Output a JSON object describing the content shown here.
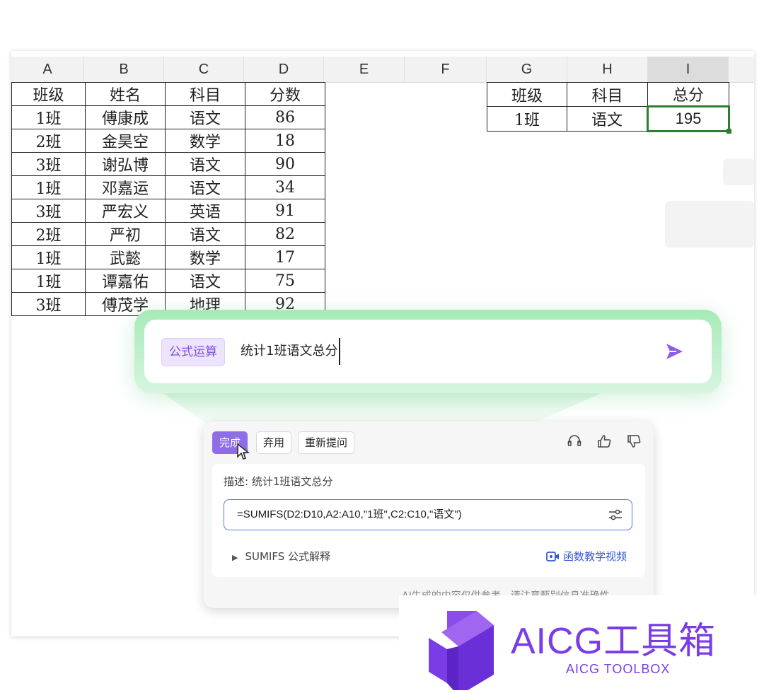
{
  "columns": [
    "A",
    "B",
    "C",
    "D",
    "E",
    "F",
    "G",
    "H",
    "I"
  ],
  "table_main": {
    "headers": [
      "班级",
      "姓名",
      "科目",
      "分数"
    ],
    "rows": [
      [
        "1班",
        "傅康成",
        "语文",
        "86"
      ],
      [
        "2班",
        "金昊空",
        "数学",
        "18"
      ],
      [
        "3班",
        "谢弘博",
        "语文",
        "90"
      ],
      [
        "1班",
        "邓嘉运",
        "语文",
        "34"
      ],
      [
        "3班",
        "严宏义",
        "英语",
        "91"
      ],
      [
        "2班",
        "严初",
        "语文",
        "82"
      ],
      [
        "1班",
        "武懿",
        "数学",
        "17"
      ],
      [
        "1班",
        "谭嘉佑",
        "语文",
        "75"
      ],
      [
        "3班",
        "傅茂学",
        "地理",
        "92"
      ]
    ]
  },
  "table_summary": {
    "headers": [
      "班级",
      "科目",
      "总分"
    ],
    "row": [
      "1班",
      "语文",
      "195"
    ]
  },
  "prompt": {
    "tag": "公式运算",
    "text": "统计1班语文总分",
    "send_icon": "send-icon"
  },
  "result_card": {
    "buttons": {
      "done": "完成",
      "discard": "弃用",
      "reask": "重新提问"
    },
    "icons": [
      "audio-icon",
      "thumbs-up-icon",
      "thumbs-down-icon"
    ],
    "description": "描述: 统计1班语文总分",
    "formula": "=SUMIFS(D2:D10,A2:A10,\"1班\",C2:C10,\"语文\")",
    "explain": "SUMIFS 公式解释",
    "video_link": "函数教学视频",
    "footnote": "AI生成的内容仅供参考，请注意甄别信息准确性"
  },
  "watermark": {
    "title": "AICG工具箱",
    "subtitle": "AICG TOOLBOX"
  },
  "colors": {
    "accent": "#8e6ee6",
    "active_cell": "#2e7d32",
    "formula_border": "#5b73e8",
    "brand": "#7a3ce6"
  }
}
